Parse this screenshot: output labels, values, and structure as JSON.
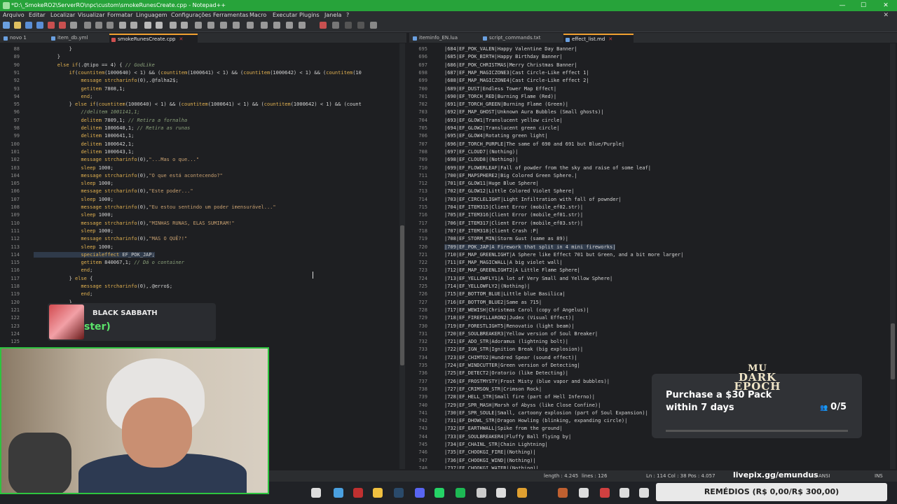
{
  "window": {
    "title": "*D:\\_SmokeRO2\\ServerRO\\npc\\custom\\smokeRunesCreate.cpp - Notepad++"
  },
  "menu": [
    "Arquivo",
    "Editar",
    "Localizar",
    "Visualizar",
    "Formatar",
    "Linguagem",
    "Configurações",
    "Ferramentas",
    "Macro",
    "Executar",
    "Plugins",
    "Janela",
    "?"
  ],
  "left_tabs": [
    {
      "label": "novo 1",
      "active": false
    },
    {
      "label": "item_db.yml",
      "active": false
    },
    {
      "label": "smokeRunesCreate.cpp",
      "active": true
    }
  ],
  "right_tabs": [
    {
      "label": "iteminfo_EN.lua",
      "active": false
    },
    {
      "label": "script_commands.txt",
      "active": false
    },
    {
      "label": "effect_list.md",
      "active": true
    }
  ],
  "left_code": [
    {
      "n": "88",
      "t": "            }"
    },
    {
      "n": "89",
      "t": "        }"
    },
    {
      "n": "90",
      "t": "        else if(.@tipo == 4) { // GodLike"
    },
    {
      "n": "91",
      "t": "            if(countitem(1000640) < 1) && (countitem(1000641) < 1) && (countitem(1000642) < 1) && (countitem(10"
    },
    {
      "n": "92",
      "t": "                message strcharinfo(0),.@falha2$;"
    },
    {
      "n": "93",
      "t": "                getitem 7808,1;"
    },
    {
      "n": "94",
      "t": "                end;"
    },
    {
      "n": "95",
      "t": "            } else if(countitem(1000640) < 1) && (countitem(1000641) < 1) && (countitem(1000642) < 1) && (count"
    },
    {
      "n": "96",
      "t": "                //delitem 1001141,1;"
    },
    {
      "n": "97",
      "t": "                delitem 7809,1; // Retira a fornalha"
    },
    {
      "n": "98",
      "t": "                delitem 1000640,1; // Retira as runas"
    },
    {
      "n": "99",
      "t": "                delitem 1000641,1;"
    },
    {
      "n": "100",
      "t": "                delitem 1000642,1;"
    },
    {
      "n": "101",
      "t": "                delitem 1000643,1;"
    },
    {
      "n": "102",
      "t": "                message strcharinfo(0),\"...Mas o que...\""
    },
    {
      "n": "103",
      "t": "                sleep 1000;"
    },
    {
      "n": "104",
      "t": "                message strcharinfo(0),\"O que está acontecendo?\""
    },
    {
      "n": "105",
      "t": "                sleep 1000;"
    },
    {
      "n": "106",
      "t": "                message strcharinfo(0),\"Este poder...\""
    },
    {
      "n": "107",
      "t": "                sleep 1000;"
    },
    {
      "n": "108",
      "t": "                message strcharinfo(0),\"Eu estou sentindo um poder imensurável...\""
    },
    {
      "n": "109",
      "t": "                sleep 1000;"
    },
    {
      "n": "110",
      "t": "                message strcharinfo(0),\"MINHAS RUNAS, ELAS SUMIRAM!\""
    },
    {
      "n": "111",
      "t": "                sleep 1000;"
    },
    {
      "n": "112",
      "t": "                message strcharinfo(0),\"MAS O QUÊ?!\""
    },
    {
      "n": "113",
      "t": "                sleep 1000;"
    },
    {
      "n": "114",
      "t": "                specialeffect EF_POK_JAP;"
    },
    {
      "n": "115",
      "t": "                getitem 840067,1; // Dá o container"
    },
    {
      "n": "116",
      "t": "                end;"
    },
    {
      "n": "117",
      "t": "            } else {"
    },
    {
      "n": "118",
      "t": "                message strcharinfo(0),.@erro$;"
    },
    {
      "n": "119",
      "t": "                end;"
    },
    {
      "n": "120",
      "t": "            }"
    },
    {
      "n": "121",
      "t": ""
    },
    {
      "n": "122",
      "t": ""
    },
    {
      "n": "123",
      "t": ""
    },
    {
      "n": "124",
      "t": ""
    },
    {
      "n": "125",
      "t": ""
    }
  ],
  "right_code": [
    {
      "n": "695",
      "t": "|684|EF_POK_VALEN|Happy Valentine Day Banner|"
    },
    {
      "n": "696",
      "t": "|685|EF_POK_BIRTH|Happy Birthday Banner|"
    },
    {
      "n": "697",
      "t": "|686|EF_POK_CHRISTMAS|Merry Christmas Banner|"
    },
    {
      "n": "698",
      "t": "|687|EF_MAP_MAGICZONE3|Cast Circle-Like effect 1|"
    },
    {
      "n": "699",
      "t": "|688|EF_MAP_MAGICZONE4|Cast Circle-Like effect 2|"
    },
    {
      "n": "700",
      "t": "|689|EF_DUST|Endless Tower Map Effect|"
    },
    {
      "n": "701",
      "t": "|690|EF_TORCH_RED|Burning Flame (Red)|"
    },
    {
      "n": "702",
      "t": "|691|EF_TORCH_GREEN|Burning Flame (Green)|"
    },
    {
      "n": "703",
      "t": "|692|EF_MAP_GHOST|Unknown Aura Bubbles (Small ghosts)|"
    },
    {
      "n": "704",
      "t": "|693|EF_GLOW1|Translucent yellow circle|"
    },
    {
      "n": "705",
      "t": "|694|EF_GLOW2|Translucent green circle|"
    },
    {
      "n": "706",
      "t": "|695|EF_GLOW4|Rotating green light|"
    },
    {
      "n": "707",
      "t": "|696|EF_TORCH_PURPLE|The same of 690 and 691 but Blue/Purple|"
    },
    {
      "n": "708",
      "t": "|697|EF_CLOUD7|(Nothing)|"
    },
    {
      "n": "709",
      "t": "|698|EF_CLOUD8|(Nothing)|"
    },
    {
      "n": "710",
      "t": "|699|EF_FLOWERLEAF|Fall of powder from the sky and raise of some leaf|"
    },
    {
      "n": "711",
      "t": "|700|EF_MAPSPHERE2|Big Colored Green Sphere.|"
    },
    {
      "n": "712",
      "t": "|701|EF_GLOW11|Huge Blue Sphere|"
    },
    {
      "n": "713",
      "t": "|702|EF_GLOW12|Little Colored Violet Sphere|"
    },
    {
      "n": "714",
      "t": "|703|EF_CIRCLELIGHT|Light Infiltration with fall of pownder|"
    },
    {
      "n": "715",
      "t": "|704|EF_ITEM315|Client Error (mobile_ef02.str)|"
    },
    {
      "n": "716",
      "t": "|705|EF_ITEM316|Client Error (mobile_ef01.str)|"
    },
    {
      "n": "717",
      "t": "|706|EF_ITEM317|Client Error (mobile_ef03.str)|"
    },
    {
      "n": "718",
      "t": "|707|EF_ITEM318|Client Crash :P|"
    },
    {
      "n": "719",
      "t": "|708|EF_STORM_MIN|Storm Gust (same as 89)|"
    },
    {
      "n": "720",
      "t": "|709|EF_POK_JAP|A Firework that split in 4 mini fireworks|"
    },
    {
      "n": "721",
      "t": "|710|EF_MAP_GREENLIGHT|A Sphere like Effect 701 but Green, and a bit more larger|"
    },
    {
      "n": "722",
      "t": "|711|EF_MAP_MAGICWALL|A big violet wall|"
    },
    {
      "n": "723",
      "t": "|712|EF_MAP_GREENLIGHT2|A Little Flame Sphere|"
    },
    {
      "n": "724",
      "t": "|713|EF_YELLOWFLY1|A lot of Very Small and Yellow Sphere|"
    },
    {
      "n": "725",
      "t": "|714|EF_YELLOWFLY2|(Nothing)|"
    },
    {
      "n": "726",
      "t": "|715|EF_BOTTOM_BLUE|Little blue Basilica|"
    },
    {
      "n": "727",
      "t": "|716|EF_BOTTOM_BLUE2|Same as 715|"
    },
    {
      "n": "728",
      "t": "|717|EF_WEWISH|Christmas Carol (copy of Angelus)|"
    },
    {
      "n": "729",
      "t": "|718|EF_FIREPILLARON2|Judex (Visual Effect)|"
    },
    {
      "n": "730",
      "t": "|719|EF_FORESTLIGHT5|Renovatio (light beam)|"
    },
    {
      "n": "731",
      "t": "|720|EF_SOULBREAKER3|Yellow version of Soul Breaker|"
    },
    {
      "n": "732",
      "t": "|721|EF_ADO_STR|Adoramus (lightning bolt)|"
    },
    {
      "n": "733",
      "t": "|722|EF_IGN_STR|Ignition Break (big explosion)|"
    },
    {
      "n": "734",
      "t": "|723|EF_CHIMTO2|Hundred Spear (sound effect)|"
    },
    {
      "n": "735",
      "t": "|724|EF_WINDCUTTER|Green version of Detecting|"
    },
    {
      "n": "736",
      "t": "|725|EF_DETECT2|Oratorio (like Detecting)|"
    },
    {
      "n": "737",
      "t": "|726|EF_FROSTMYSTY|Frost Misty (blue vapor and bubbles)|"
    },
    {
      "n": "738",
      "t": "|727|EF_CRIMSON_STR|Crimson Rock|"
    },
    {
      "n": "739",
      "t": "|728|EF_HELL_STR|Small fire (part of Hell Inferno)|"
    },
    {
      "n": "740",
      "t": "|729|EF_SPR_MASH|Marsh of Abyss (like Close Confine)|"
    },
    {
      "n": "741",
      "t": "|730|EF_SPR_SOULE|Small, cartoony explosion (part of Soul Expansion)|"
    },
    {
      "n": "742",
      "t": "|731|EF_DHOWL_STR|Dragon Howling (blinking, expanding circle)|"
    },
    {
      "n": "743",
      "t": "|732|EF_EARTHWALL|Spike from the ground|"
    },
    {
      "n": "744",
      "t": "|733|EF_SOULBREAKER4|Fluffy Ball flying by|"
    },
    {
      "n": "745",
      "t": "|734|EF_CHAINL_STR|Chain Lightning|"
    },
    {
      "n": "746",
      "t": "|735|EF_CHOOKGI_FIRE|(Nothing)|"
    },
    {
      "n": "747",
      "t": "|736|EF_CHOOKGI_WIND|(Nothing)|"
    },
    {
      "n": "748",
      "t": "|737|EF_CHOOKGI_WATER|(Nothing)|"
    }
  ],
  "status": {
    "length": "length : 4.245",
    "lines": "lines : 126",
    "position": "Ln : 114   Col : 38   Pos : 4.057",
    "encoding": "ANSI",
    "mode": "INS"
  },
  "music": {
    "artist": "BLACK SABBATH",
    "track": "ster)"
  },
  "promo": {
    "logo_top": "MU",
    "logo_bottom": "DARK EPOCH",
    "message": "Purchase a $30 Pack within 7 days",
    "progress": "0/5"
  },
  "overlay": {
    "livepix": "livepix.gg/emundus",
    "goal": "REMÉDIOS (R$ 0,00/R$ 300,00)"
  }
}
